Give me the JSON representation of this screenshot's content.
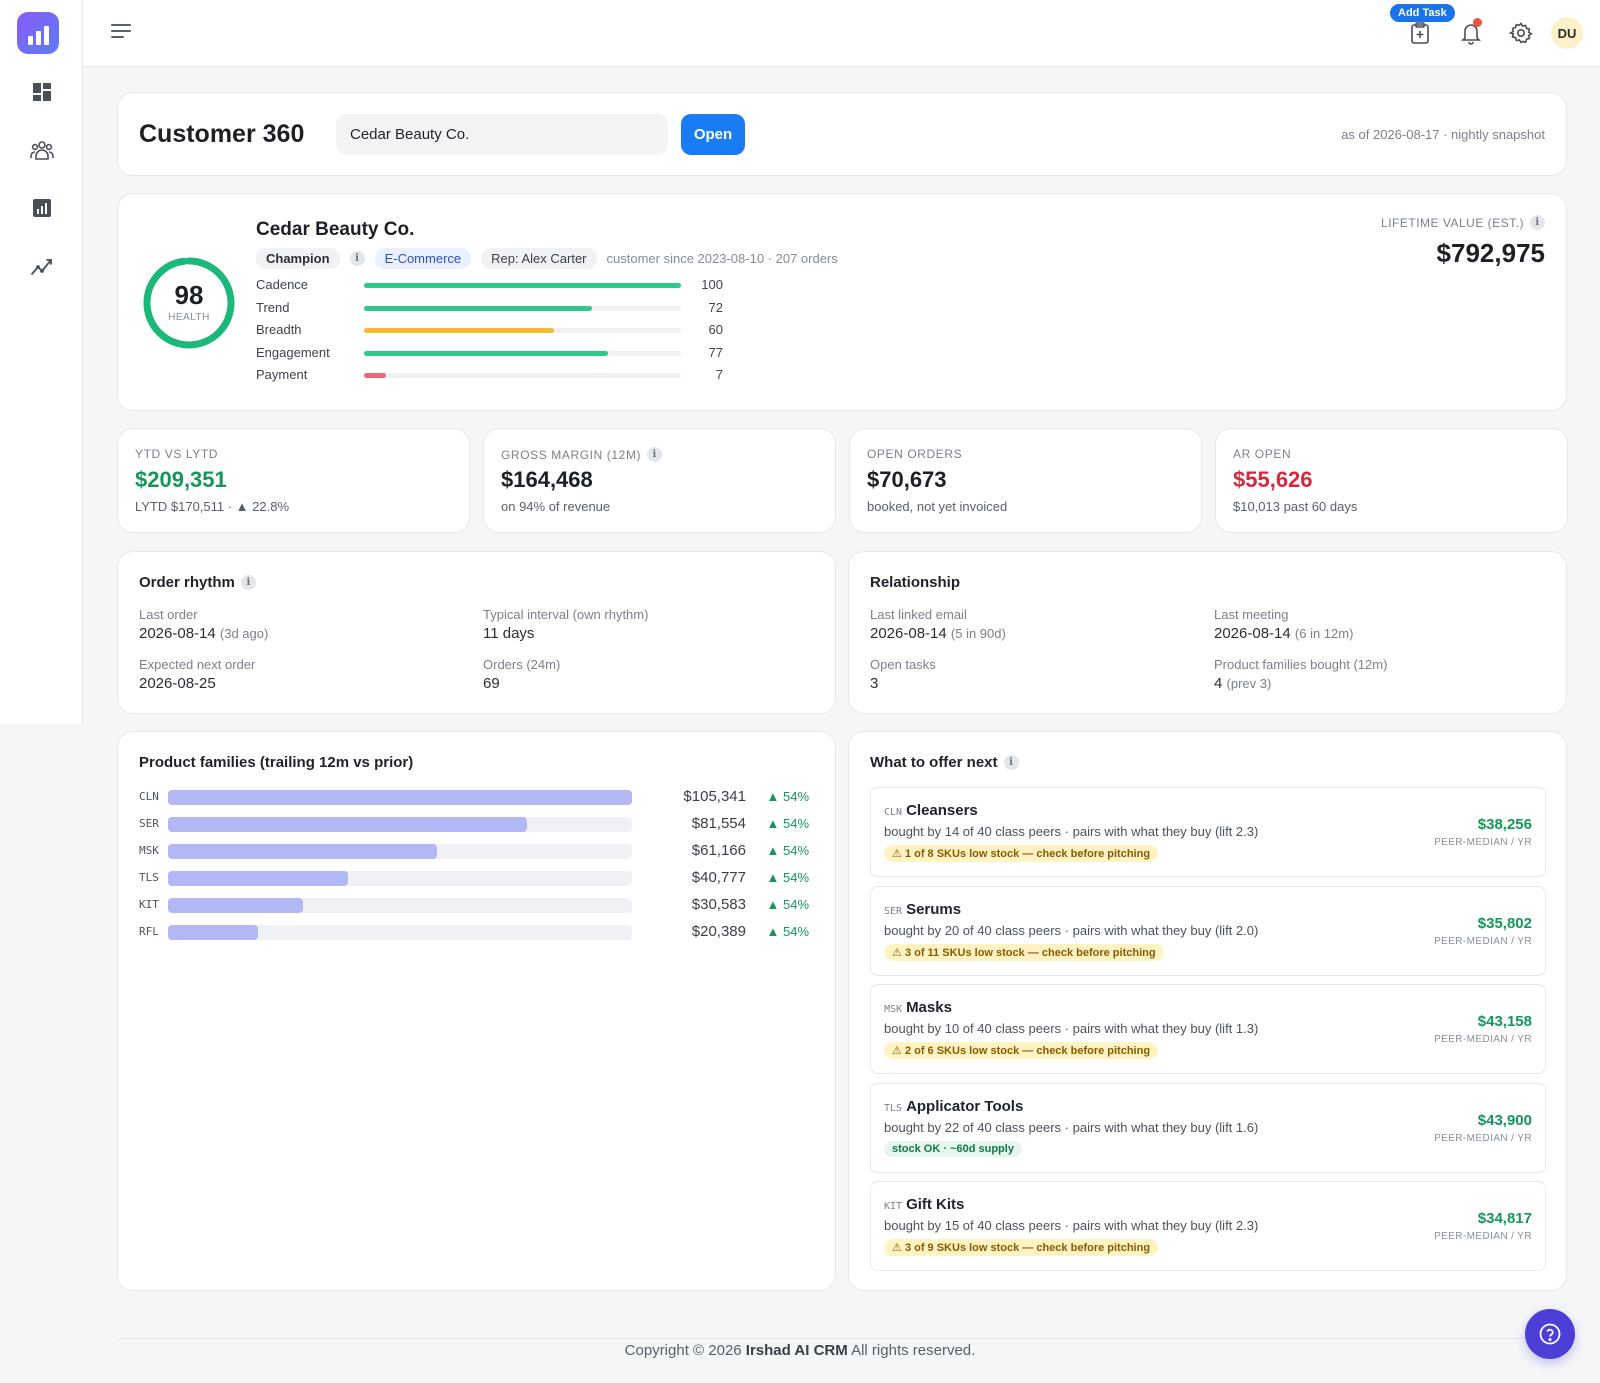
{
  "topbar": {
    "add_task_label": "Add Task",
    "avatar_initials": "DU"
  },
  "header": {
    "title": "Customer 360",
    "search_value": "Cedar Beauty Co.",
    "open_label": "Open",
    "snapshot": "as of 2026-08-17 · nightly snapshot"
  },
  "profile": {
    "health_score": "98",
    "health_label": "HEALTH",
    "health_value": 98,
    "name": "Cedar Beauty Co.",
    "segment": "Champion",
    "info": "i",
    "channel": "E-Commerce",
    "rep": "Rep: Alex Carter",
    "since": "customer since 2023-08-10 · 207 orders",
    "metrics": [
      {
        "label": "Cadence",
        "value": "100",
        "pct": 100,
        "color": "#2dc98a"
      },
      {
        "label": "Trend",
        "value": "72",
        "pct": 72,
        "color": "#2dc98a"
      },
      {
        "label": "Breadth",
        "value": "60",
        "pct": 60,
        "color": "#f6bb33"
      },
      {
        "label": "Engagement",
        "value": "77",
        "pct": 77,
        "color": "#2dc98a"
      },
      {
        "label": "Payment",
        "value": "7",
        "pct": 7,
        "color": "#f06478"
      }
    ],
    "lifetime_label": "LIFETIME VALUE (EST.)",
    "lifetime_value": "$792,975"
  },
  "kpis": [
    {
      "label": "YTD VS LYTD",
      "value": "$209,351",
      "sub": "LYTD $170,511 · ▲ 22.8%",
      "tone": "green",
      "info": false
    },
    {
      "label": "GROSS MARGIN (12M)",
      "value": "$164,468",
      "sub": "on 94% of revenue",
      "tone": "",
      "info": true
    },
    {
      "label": "OPEN ORDERS",
      "value": "$70,673",
      "sub": "booked, not yet invoiced",
      "tone": "",
      "info": false
    },
    {
      "label": "AR OPEN",
      "value": "$55,626",
      "sub": "$10,013 past 60 days",
      "tone": "red",
      "info": false
    }
  ],
  "order_rhythm": {
    "title": "Order rhythm",
    "last_order_label": "Last order",
    "last_order": "2026-08-14",
    "last_order_note": "(3d ago)",
    "interval_label": "Typical interval (own rhythm)",
    "interval": "11 days",
    "next_label": "Expected next order",
    "next": "2026-08-25",
    "orders_label": "Orders (24m)",
    "orders": "69"
  },
  "relationship": {
    "title": "Relationship",
    "email_label": "Last linked email",
    "email": "2026-08-14",
    "email_note": "(5 in 90d)",
    "meeting_label": "Last meeting",
    "meeting": "2026-08-14",
    "meeting_note": "(6 in 12m)",
    "tasks_label": "Open tasks",
    "tasks": "3",
    "families_label": "Product families bought (12m)",
    "families": "4",
    "families_note": "(prev 3)"
  },
  "product_families": {
    "title": "Product families (trailing 12m vs prior)",
    "rows": [
      {
        "code": "CLN",
        "amount": "$105,341",
        "value": 105341,
        "change": "▲ 54%"
      },
      {
        "code": "SER",
        "amount": "$81,554",
        "value": 81554,
        "change": "▲ 54%"
      },
      {
        "code": "MSK",
        "amount": "$61,166",
        "value": 61166,
        "change": "▲ 54%"
      },
      {
        "code": "TLS",
        "amount": "$40,777",
        "value": 40777,
        "change": "▲ 54%"
      },
      {
        "code": "KIT",
        "amount": "$30,583",
        "value": 30583,
        "change": "▲ 54%"
      },
      {
        "code": "RFL",
        "amount": "$20,389",
        "value": 20389,
        "change": "▲ 54%"
      }
    ]
  },
  "offers": {
    "title": "What to offer next",
    "items": [
      {
        "code": "CLN",
        "name": "Cleansers",
        "desc": "bought by 14 of 40 class peers · pairs with what they buy (lift 2.3)",
        "stock": "1 of 8 SKUs low stock — check before pitching",
        "ok": false,
        "amount": "$38,256",
        "unit": "PEER-MEDIAN / YR"
      },
      {
        "code": "SER",
        "name": "Serums",
        "desc": "bought by 20 of 40 class peers · pairs with what they buy (lift 2.0)",
        "stock": "3 of 11 SKUs low stock — check before pitching",
        "ok": false,
        "amount": "$35,802",
        "unit": "PEER-MEDIAN / YR"
      },
      {
        "code": "MSK",
        "name": "Masks",
        "desc": "bought by 10 of 40 class peers · pairs with what they buy (lift 1.3)",
        "stock": "2 of 6 SKUs low stock — check before pitching",
        "ok": false,
        "amount": "$43,158",
        "unit": "PEER-MEDIAN / YR"
      },
      {
        "code": "TLS",
        "name": "Applicator Tools",
        "desc": "bought by 22 of 40 class peers · pairs with what they buy (lift 1.6)",
        "stock": "stock OK · ~60d supply",
        "ok": true,
        "amount": "$43,900",
        "unit": "PEER-MEDIAN / YR"
      },
      {
        "code": "KIT",
        "name": "Gift Kits",
        "desc": "bought by 15 of 40 class peers · pairs with what they buy (lift 2.3)",
        "stock": "3 of 9 SKUs low stock — check before pitching",
        "ok": false,
        "amount": "$34,817",
        "unit": "PEER-MEDIAN / YR"
      }
    ]
  },
  "footer": {
    "prefix": "Copyright © 2026",
    "brand": "Irshad AI CRM",
    "suffix": "All rights reserved."
  },
  "colors": {
    "accent": "#1a7cf5",
    "positive": "#15965a",
    "negative": "#d5283d",
    "health_ring": "#1ab879"
  }
}
